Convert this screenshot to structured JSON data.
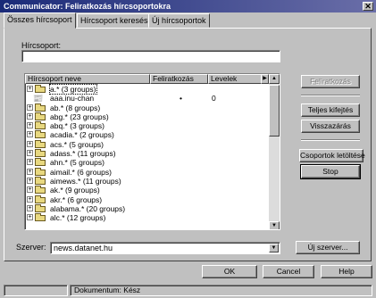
{
  "window": {
    "title": "Communicator: Feliratkozás hírcsoportokra",
    "close_glyph": "✕"
  },
  "tabs": [
    {
      "label": "Összes hírcsoport"
    },
    {
      "label": "Hírcsoport keresése"
    },
    {
      "label": "Új hírcsoportok"
    }
  ],
  "filter": {
    "label": "Hírcsoport:",
    "value": ""
  },
  "list": {
    "columns": [
      "Hírcsoport neve",
      "Feliratkozás",
      "Levelek"
    ],
    "rows": [
      {
        "name": "a.* (3 groups)",
        "type": "folder",
        "subscribed": "",
        "count": ""
      },
      {
        "name": "aaa.inu-chan",
        "type": "newsgroup",
        "subscribed": "•",
        "count": "0"
      },
      {
        "name": "ab.* (8 groups)",
        "type": "folder",
        "subscribed": "",
        "count": ""
      },
      {
        "name": "abg.* (23 groups)",
        "type": "folder",
        "subscribed": "",
        "count": ""
      },
      {
        "name": "abq.* (3 groups)",
        "type": "folder",
        "subscribed": "",
        "count": ""
      },
      {
        "name": "acadia.* (2 groups)",
        "type": "folder",
        "subscribed": "",
        "count": ""
      },
      {
        "name": "acs.* (5 groups)",
        "type": "folder",
        "subscribed": "",
        "count": ""
      },
      {
        "name": "adass.* (11 groups)",
        "type": "folder",
        "subscribed": "",
        "count": ""
      },
      {
        "name": "ahn.* (5 groups)",
        "type": "folder",
        "subscribed": "",
        "count": ""
      },
      {
        "name": "aimail.* (6 groups)",
        "type": "folder",
        "subscribed": "",
        "count": ""
      },
      {
        "name": "aimews.* (11 groups)",
        "type": "folder",
        "subscribed": "",
        "count": ""
      },
      {
        "name": "ak.* (9 groups)",
        "type": "folder",
        "subscribed": "",
        "count": ""
      },
      {
        "name": "akr.* (6 groups)",
        "type": "folder",
        "subscribed": "",
        "count": ""
      },
      {
        "name": "alabama.* (20 groups)",
        "type": "folder",
        "subscribed": "",
        "count": ""
      },
      {
        "name": "alc.* (12 groups)",
        "type": "folder",
        "subscribed": "",
        "count": ""
      }
    ]
  },
  "buttons": {
    "subscribe": "Feliratkozás",
    "expand_all": "Teljes kifejtés",
    "collapse": "Visszazárás",
    "download_groups": "Csoportok letöltése",
    "stop": "Stop",
    "new_server": "Új szerver...",
    "ok": "OK",
    "cancel": "Cancel",
    "help": "Help"
  },
  "server": {
    "label": "Szerver:",
    "value": "news.datanet.hu"
  },
  "status": {
    "text": "Dokumentum: Kész"
  }
}
